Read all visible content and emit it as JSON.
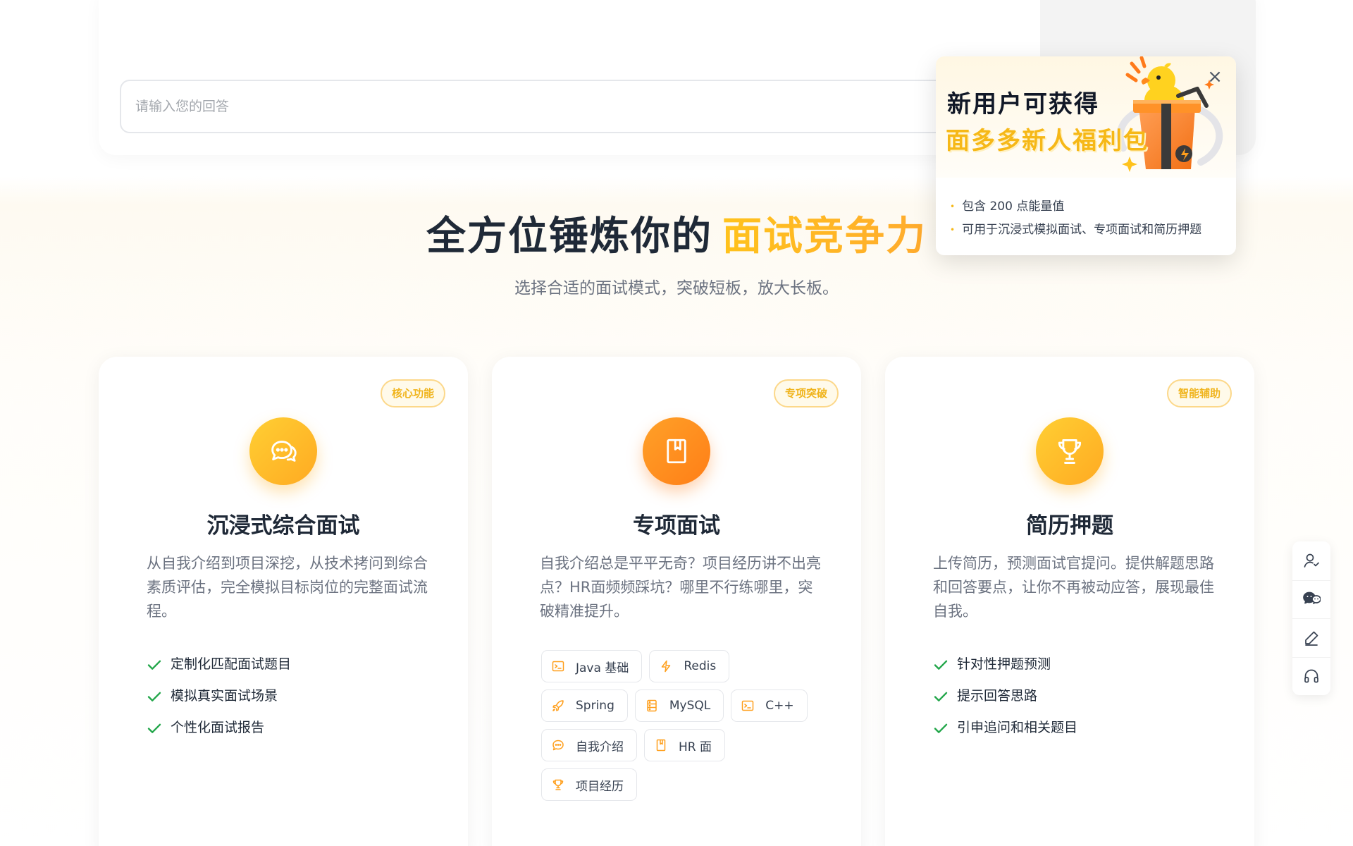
{
  "answer_input": {
    "placeholder": "请输入您的回答"
  },
  "popup": {
    "title_line1": "新用户可获得",
    "title_line2": "面多多新人福利包",
    "benefits": [
      "包含 200 点能量值",
      "可用于沉浸式模拟面试、专项面试和简历押题"
    ],
    "close_icon": "close-icon",
    "illustration": "duck-gift-illustration"
  },
  "section": {
    "title_main": "全方位锤炼你的",
    "title_highlight": "面试竞争力",
    "subtitle": "选择合适的面试模式，突破短板，放大长板。"
  },
  "colors": {
    "accent": "#ffb71d",
    "accent_orange": "#ff8a1d",
    "check_green": "#22a64a",
    "badge_border": "#fcd88a"
  },
  "cards": [
    {
      "badge": "核心功能",
      "icon": "chat-bubbles-icon",
      "title": "沉浸式综合面试",
      "desc": "从自我介绍到项目深挖，从技术拷问到综合素质评估，完全模拟目标岗位的完整面试流程。",
      "features": [
        "定制化匹配面试题目",
        "模拟真实面试场景",
        "个性化面试报告"
      ]
    },
    {
      "badge": "专项突破",
      "icon": "bookmark-book-icon",
      "title": "专项面试",
      "desc": "自我介绍总是平平无奇？项目经历讲不出亮点？HR面频频踩坑？哪里不行练哪里，突破精准提升。",
      "tags": [
        {
          "label": "Java 基础",
          "icon": "terminal-icon"
        },
        {
          "label": "Redis",
          "icon": "lightning-icon"
        },
        {
          "label": "Spring",
          "icon": "rocket-icon"
        },
        {
          "label": "MySQL",
          "icon": "database-icon"
        },
        {
          "label": "C++",
          "icon": "terminal-icon"
        },
        {
          "label": "自我介绍",
          "icon": "chat-icon"
        },
        {
          "label": "HR 面",
          "icon": "bookmark-icon"
        },
        {
          "label": "项目经历",
          "icon": "trophy-icon"
        }
      ]
    },
    {
      "badge": "智能辅助",
      "icon": "trophy-icon",
      "title": "简历押题",
      "desc": "上传简历，预测面试官提问。提供解题思路和回答要点，让你不再被动应答，展现最佳自我。",
      "features": [
        "针对性押题预测",
        "提示回答思路",
        "引申追问和相关题目"
      ]
    }
  ],
  "float_bar": {
    "items": [
      "user-add-icon",
      "wechat-icon",
      "edit-icon",
      "headset-icon"
    ]
  }
}
